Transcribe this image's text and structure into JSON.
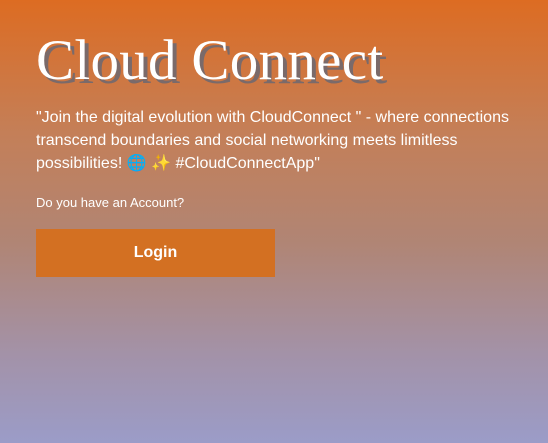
{
  "hero": {
    "title": "Cloud Connect",
    "tagline": "\"Join the digital evolution with CloudConnect \" - where connections transcend boundaries and social networking meets limitless possibilities! 🌐 ✨ #CloudConnectApp\"",
    "account_question": "Do you have an Account?"
  },
  "actions": {
    "login_label": "Login"
  },
  "colors": {
    "gradient_top": "#dd6c22",
    "gradient_bottom": "#9b9cc8",
    "button": "#d37022",
    "text": "#ffffff"
  }
}
